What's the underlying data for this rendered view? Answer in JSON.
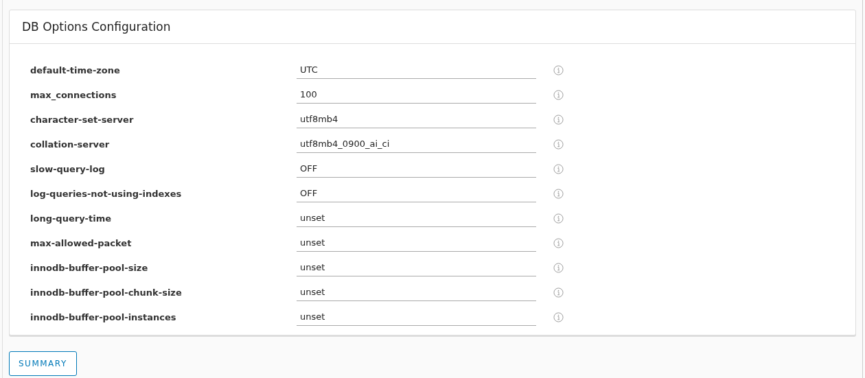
{
  "card": {
    "title": "DB Options Configuration"
  },
  "options": [
    {
      "name": "default-time-zone",
      "value": "UTC"
    },
    {
      "name": "max_connections",
      "value": "100"
    },
    {
      "name": "character-set-server",
      "value": "utf8mb4"
    },
    {
      "name": "collation-server",
      "value": "utf8mb4_0900_ai_ci"
    },
    {
      "name": "slow-query-log",
      "value": "OFF"
    },
    {
      "name": "log-queries-not-using-indexes",
      "value": "OFF"
    },
    {
      "name": "long-query-time",
      "value": "unset"
    },
    {
      "name": "max-allowed-packet",
      "value": "unset"
    },
    {
      "name": "innodb-buffer-pool-size",
      "value": "unset"
    },
    {
      "name": "innodb-buffer-pool-chunk-size",
      "value": "unset"
    },
    {
      "name": "innodb-buffer-pool-instances",
      "value": "unset"
    }
  ],
  "buttons": [
    "SUMMARY"
  ]
}
